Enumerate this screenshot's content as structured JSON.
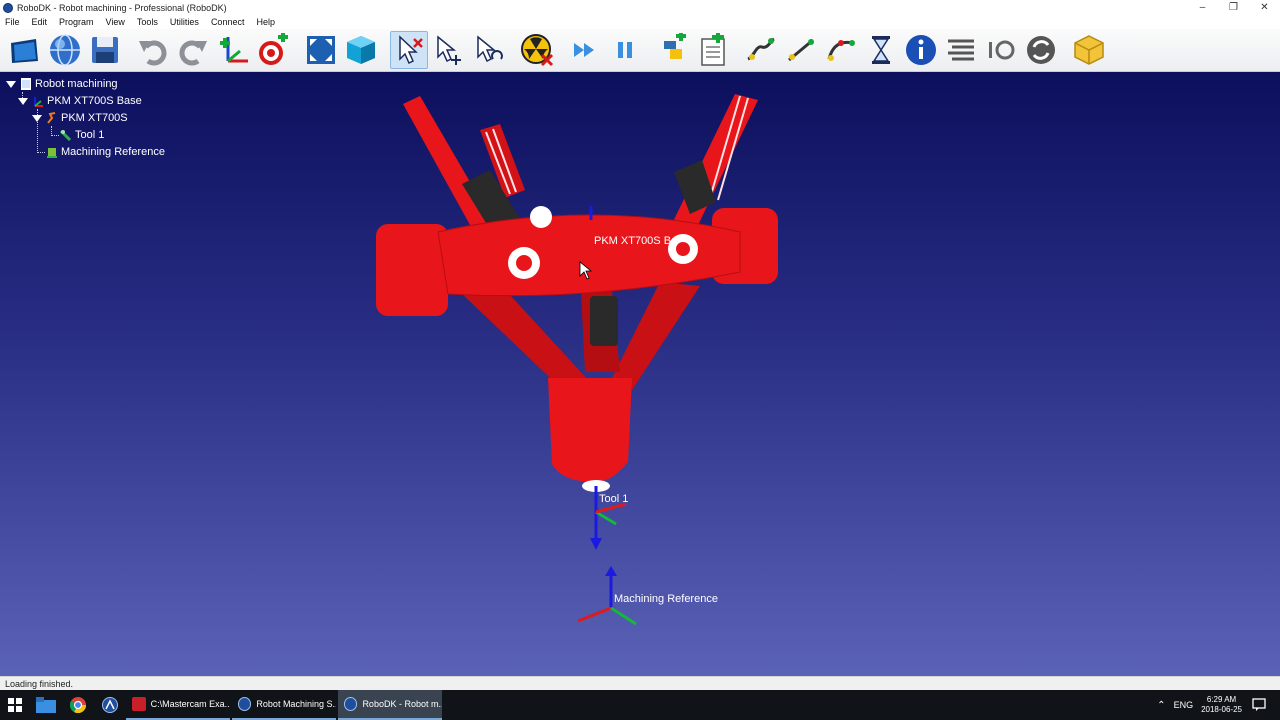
{
  "window": {
    "title": "RoboDK - Robot machining - Professional (RoboDK)",
    "controls": {
      "minimize": "–",
      "restore": "❐",
      "close": "✕"
    }
  },
  "menu": [
    "File",
    "Edit",
    "Program",
    "View",
    "Tools",
    "Utilities",
    "Connect",
    "Help"
  ],
  "toolbar": {
    "icons": [
      "open-icon",
      "globe-icon",
      "save-icon",
      "undo-icon",
      "redo-icon",
      "add-reference-frame-icon",
      "add-target-icon",
      "fit-all-icon",
      "cube-view-icon",
      "select-icon",
      "select-move-icon",
      "select-rotate-icon",
      "collision-check-icon",
      "run-simulation-icon",
      "pause-icon",
      "python-program-icon",
      "add-program-icon",
      "move-joint-icon",
      "move-linear-icon",
      "move-circular-icon",
      "pause-timer-icon",
      "info-icon",
      "program-instruction-icon",
      "io-icon",
      "subprogram-call-icon",
      "extension-icon"
    ]
  },
  "tree": {
    "root": "Robot machining",
    "base": "PKM XT700S Base",
    "robot": "PKM XT700S",
    "tool": "Tool 1",
    "reference": "Machining Reference"
  },
  "scene": {
    "base_label": "PKM XT700S Ba",
    "tool_label": "Tool 1",
    "reference_label": "Machining Reference"
  },
  "status": "Loading finished.",
  "taskbar": {
    "windows": [
      {
        "label": "C:\\Mastercam Exa...",
        "active": false
      },
      {
        "label": "Robot Machining S...",
        "active": false
      },
      {
        "label": "RoboDK - Robot m...",
        "active": true
      }
    ],
    "language": "ENG",
    "time": "6:29 AM",
    "date": "2018-06-25"
  },
  "colors": {
    "robot": "#e8161b",
    "viewport_top": "#0c0f5c",
    "viewport_bottom": "#5a62b6"
  }
}
